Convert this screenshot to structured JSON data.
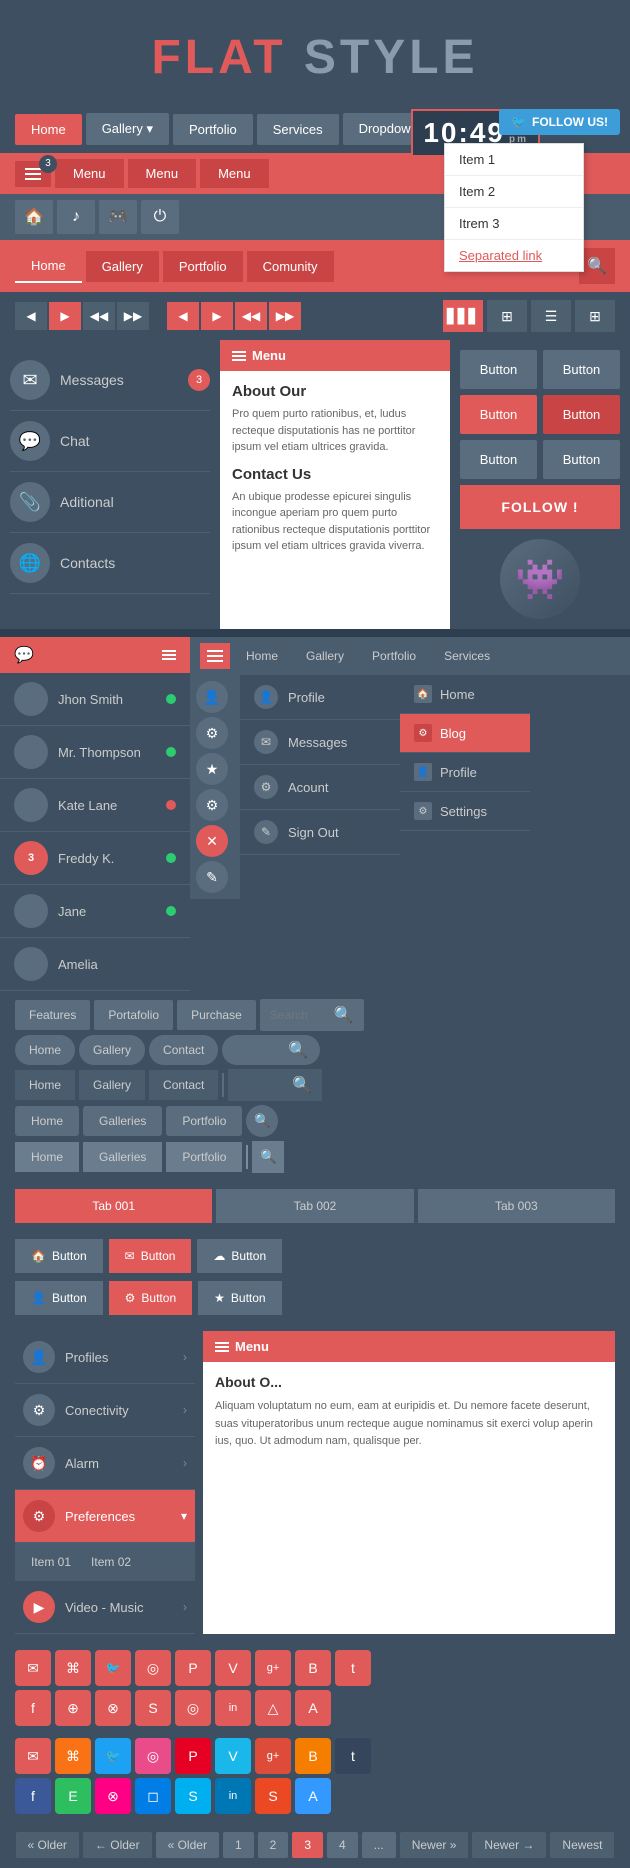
{
  "header": {
    "title_red": "FLAT",
    "title_gray": "STYLE"
  },
  "nav1": {
    "home": "Home",
    "gallery": "Gallery ▾",
    "portfolio": "Portfolio",
    "services": "Services",
    "dropdown": "Dropdown ▾"
  },
  "dropdown_menu": {
    "item1": "Item 1",
    "item2": "Item 2",
    "item3": "Itrem 3",
    "separated": "Separated link"
  },
  "clock": {
    "hours": "10",
    "colon1": ":",
    "minutes": "49",
    "pm": "pm"
  },
  "twitter": {
    "label": "FOLLOW US!"
  },
  "nav2": {
    "menu1": "Menu",
    "menu2": "Menu",
    "menu3": "Menu",
    "badge": "3"
  },
  "nav4": {
    "home": "Home",
    "gallery": "Gallery",
    "portfolio": "Portfolio",
    "community": "Comunity"
  },
  "messages": {
    "messages_label": "Messages",
    "messages_badge": "3",
    "chat_label": "Chat",
    "additional_label": "Aditional",
    "contacts_label": "Contacts"
  },
  "modal": {
    "menu_label": "Menu",
    "about_title": "About Our",
    "about_text": "Pro quem purto rationibus, et, ludus recteque disputationis has ne porttitor ipsum vel etiam ultrices gravida.",
    "contact_title": "Contact Us",
    "contact_text": "An ubique prodesse epicurei singulis incongue aperiam pro quem purto rationibus recteque disputationis porttitor ipsum vel etiam ultrices gravida viverra."
  },
  "buttons": {
    "btn1": "Button",
    "btn2": "Button",
    "btn3": "Button",
    "btn4": "Button",
    "btn5": "Button",
    "btn6": "Button",
    "follow": "FOLLOW !"
  },
  "chat_list": {
    "users": [
      {
        "name": "Jhon Smith",
        "status": "green"
      },
      {
        "name": "Mr. Thompson",
        "status": "green"
      },
      {
        "name": "Kate Lane",
        "status": "red"
      },
      {
        "name": "Freddy K.",
        "status": "green",
        "badge": "3"
      },
      {
        "name": "Jane",
        "status": "green"
      },
      {
        "name": "Amelia",
        "status": ""
      }
    ]
  },
  "profile_dropdown": {
    "profile": "Profile",
    "messages": "Messages",
    "account": "Acount",
    "signout": "Sign Out"
  },
  "side_menu": {
    "home": "Home",
    "blog": "Blog",
    "profile": "Profile",
    "settings": "Settings"
  },
  "nav_search_rows": {
    "row1": {
      "features": "Features",
      "portfolio": "Portafolio",
      "purchase": "Purchase",
      "search_placeholder": "Search"
    },
    "row2": {
      "home": "Home",
      "gallery": "Gallery",
      "contact": "Contact"
    },
    "row3": {
      "home": "Home",
      "gallery": "Gallery",
      "contact": "Contact"
    },
    "row4": {
      "home": "Home",
      "galleries": "Galleries",
      "portfolio": "Portfolio"
    },
    "row5": {
      "home": "Home",
      "galleries": "Galleries",
      "portfolio": "Portfolio"
    }
  },
  "tabs": {
    "tab1": "Tab 001",
    "tab2": "Tab 002",
    "tab3": "Tab 003"
  },
  "icon_buttons": {
    "btn1": "Button",
    "btn2": "Button",
    "btn3": "Button",
    "btn4": "Button",
    "btn5": "Button",
    "btn6": "Button"
  },
  "settings_sidebar": {
    "profiles": "Profiles",
    "connectivity": "Conectivity",
    "alarm": "Alarm",
    "preferences": "Preferences",
    "item01": "Item 01",
    "item02": "Item 02",
    "video_music": "Video - Music"
  },
  "settings_modal": {
    "menu": "Menu",
    "about_title": "About O...",
    "about_text": "Aliquam voluptatum no eum, eam at euripidis et. Du nemore facete deserunt, suas vituperatoribus unum recteque augue nominamus sit exerci volup aperin ius, quo. Ut admodum nam, qualisque per."
  },
  "pagination": {
    "older1": "« Older",
    "older2": "← Older",
    "page1": "1",
    "page2": "2",
    "page3": "3",
    "page4": "4",
    "ellipsis": "...",
    "newer1": "Newer »",
    "newer2": "Newer →",
    "newest": "Newest"
  },
  "social_icons_red": [
    "✉",
    "⌘",
    "🐦",
    "◎",
    "℗",
    "V",
    "g+",
    "B",
    "t"
  ],
  "social_icons_red2": [
    "f",
    "⊕",
    "⊗",
    "S",
    "◎",
    "in",
    "△",
    "A"
  ],
  "social_icons_color": [
    "✉",
    "⌘",
    "🐦",
    "◎",
    "℗",
    "V",
    "g+",
    "B",
    "t"
  ],
  "social_colors": {
    "email": "#e05a5a",
    "rss": "#f97316",
    "twitter": "#1da1f2",
    "dribbble": "#ea4c89",
    "pinterest": "#e60023",
    "vimeo": "#1ab7ea",
    "gplus": "#dd4b39",
    "blogger": "#f57d00",
    "tumblr": "#35465c",
    "facebook": "#3b5998",
    "evernote": "#2dbe60",
    "flickr": "#ff0084",
    "dropbox": "#007ee5",
    "skype": "#00aff0",
    "linkedin": "#0077b5",
    "stumble": "#eb4924",
    "delicious": "#3399ff"
  }
}
